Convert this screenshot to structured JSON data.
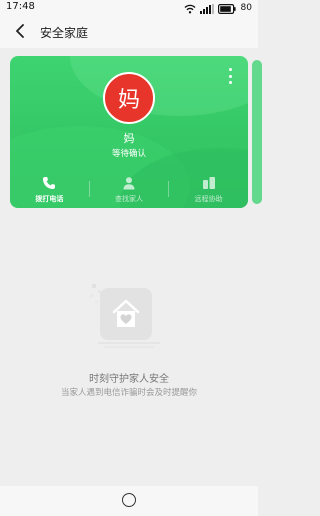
{
  "status_bar": {
    "time": "17:48",
    "battery_level": "80",
    "icons": [
      "wifi-icon",
      "signal-icon",
      "battery-icon"
    ]
  },
  "header": {
    "title": "安全家庭",
    "back_icon": "back-arrow-icon"
  },
  "member_card": {
    "avatar_text": "妈",
    "name": "妈",
    "status": "等待确认",
    "more_icon": "more-vertical-icon",
    "accent_color": "#36c867",
    "avatar_color": "#e8352b",
    "actions": [
      {
        "label": "拨打电话",
        "icon": "phone-icon",
        "active": true
      },
      {
        "label": "查找家人",
        "icon": "person-icon",
        "active": false
      },
      {
        "label": "远程协助",
        "icon": "remote-assist-icon",
        "active": false
      }
    ]
  },
  "empty_state": {
    "illustration_icon": "house-heart-icon",
    "title": "时刻守护家人安全",
    "subtitle": "当家人遇到电信诈骗时会及时提醒你"
  },
  "nav_bar": {
    "home_icon": "home-circle-icon"
  }
}
